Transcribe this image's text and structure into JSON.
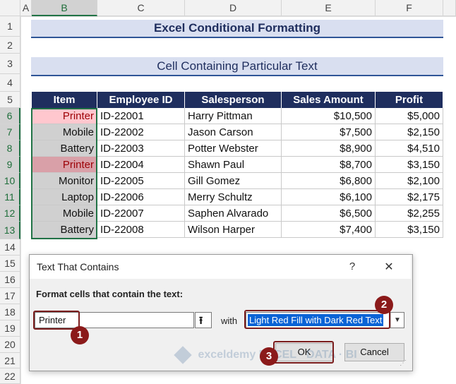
{
  "columns": [
    "A",
    "B",
    "C",
    "D",
    "E",
    "F"
  ],
  "rows": [
    "1",
    "2",
    "3",
    "4",
    "5",
    "6",
    "7",
    "8",
    "9",
    "10",
    "11",
    "12",
    "13",
    "14",
    "15",
    "16",
    "17",
    "18",
    "19",
    "20",
    "21",
    "22"
  ],
  "title": "Excel Conditional Formatting",
  "subtitle": "Cell Containing Particular Text",
  "table": {
    "headers": [
      "Item",
      "Employee ID",
      "Salesperson",
      "Sales Amount",
      "Profit"
    ],
    "rows": [
      {
        "item": "Printer",
        "id": "ID-22001",
        "salesperson": "Harry Pittman",
        "sales": "$10,500",
        "profit": "$5,000"
      },
      {
        "item": "Mobile",
        "id": "ID-22002",
        "salesperson": "Jason Carson",
        "sales": "$7,500",
        "profit": "$2,150"
      },
      {
        "item": "Battery",
        "id": "ID-22003",
        "salesperson": "Potter Webster",
        "sales": "$8,900",
        "profit": "$4,510"
      },
      {
        "item": "Printer",
        "id": "ID-22004",
        "salesperson": "Shawn Paul",
        "sales": "$8,700",
        "profit": "$3,150"
      },
      {
        "item": "Monitor",
        "id": "ID-22005",
        "salesperson": "Gill Gomez",
        "sales": "$6,800",
        "profit": "$2,100"
      },
      {
        "item": "Laptop",
        "id": "ID-22006",
        "salesperson": "Merry Schultz",
        "sales": "$6,100",
        "profit": "$2,175"
      },
      {
        "item": "Mobile",
        "id": "ID-22007",
        "salesperson": "Saphen Alvarado",
        "sales": "$6,500",
        "profit": "$2,255"
      },
      {
        "item": "Battery",
        "id": "ID-22008",
        "salesperson": "Wilson Harper",
        "sales": "$7,400",
        "profit": "$3,150"
      }
    ]
  },
  "colors": {
    "header_fill": "#1f2e5e",
    "title_fill": "#d9dff0",
    "selection_fill": "#d0d0d0",
    "highlight_fill": "#ffc7ce",
    "highlight_text": "#9c0006",
    "callout": "#8b1a1a"
  },
  "dialog": {
    "title": "Text That Contains",
    "help": "?",
    "close": "✕",
    "prompt": "Format cells that contain the text:",
    "input_value": "Printer",
    "with_label": "with",
    "format_value": "Light Red Fill with Dark Red Text",
    "ok_label": "OK",
    "cancel_label": "Cancel"
  },
  "callouts": [
    "1",
    "2",
    "3"
  ],
  "watermark": "exceldemy EXCEL · DATA · BI"
}
